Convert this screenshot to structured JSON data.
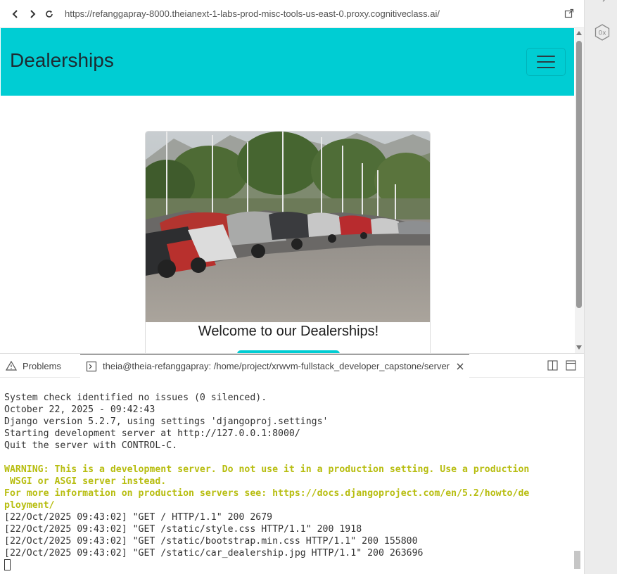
{
  "browser": {
    "back_icon": "chevron-left-icon",
    "forward_icon": "chevron-right-icon",
    "reload_icon": "reload-icon",
    "url": "https://refanggapray-8000.theianext-1-labs-prod-misc-tools-us-east-0.proxy.cognitiveclass.ai/",
    "open_external_icon": "open-external-icon"
  },
  "page": {
    "brand": "Dealerships",
    "navbar_color": "#00cdd3",
    "card_title": "Welcome to our Dealerships!"
  },
  "panel": {
    "tabs": [
      {
        "label": "Problems",
        "icon": "warning-icon"
      },
      {
        "label": "theia@theia-refanggapray: /home/project/xrwvm-fullstack_developer_capstone/server",
        "icon": "terminal-icon"
      }
    ],
    "terminal_lines": [
      {
        "text": "System check identified no issues (0 silenced).",
        "style": "normal"
      },
      {
        "text": "October 22, 2025 - 09:42:43",
        "style": "normal"
      },
      {
        "text": "Django version 5.2.7, using settings 'djangoproj.settings'",
        "style": "normal"
      },
      {
        "text": "Starting development server at http://127.0.0.1:8000/",
        "style": "normal"
      },
      {
        "text": "Quit the server with CONTROL-C.",
        "style": "normal"
      },
      {
        "text": "",
        "style": "normal"
      },
      {
        "text": "WARNING: This is a development server. Do not use it in a production setting. Use a production",
        "style": "warn"
      },
      {
        "text": " WSGI or ASGI server instead.",
        "style": "warn"
      },
      {
        "text": "For more information on production servers see: https://docs.djangoproject.com/en/5.2/howto/de",
        "style": "warn"
      },
      {
        "text": "ployment/",
        "style": "warn"
      },
      {
        "text": "[22/Oct/2025 09:43:02] \"GET / HTTP/1.1\" 200 2679",
        "style": "normal"
      },
      {
        "text": "[22/Oct/2025 09:43:02] \"GET /static/style.css HTTP/1.1\" 200 1918",
        "style": "normal"
      },
      {
        "text": "[22/Oct/2025 09:43:02] \"GET /static/bootstrap.min.css HTTP/1.1\" 200 155800",
        "style": "normal"
      },
      {
        "text": "[22/Oct/2025 09:43:02] \"GET /static/car_dealership.jpg HTTP/1.1\" 200 263696",
        "style": "normal"
      }
    ],
    "warn_color": "#b7bd0f"
  }
}
